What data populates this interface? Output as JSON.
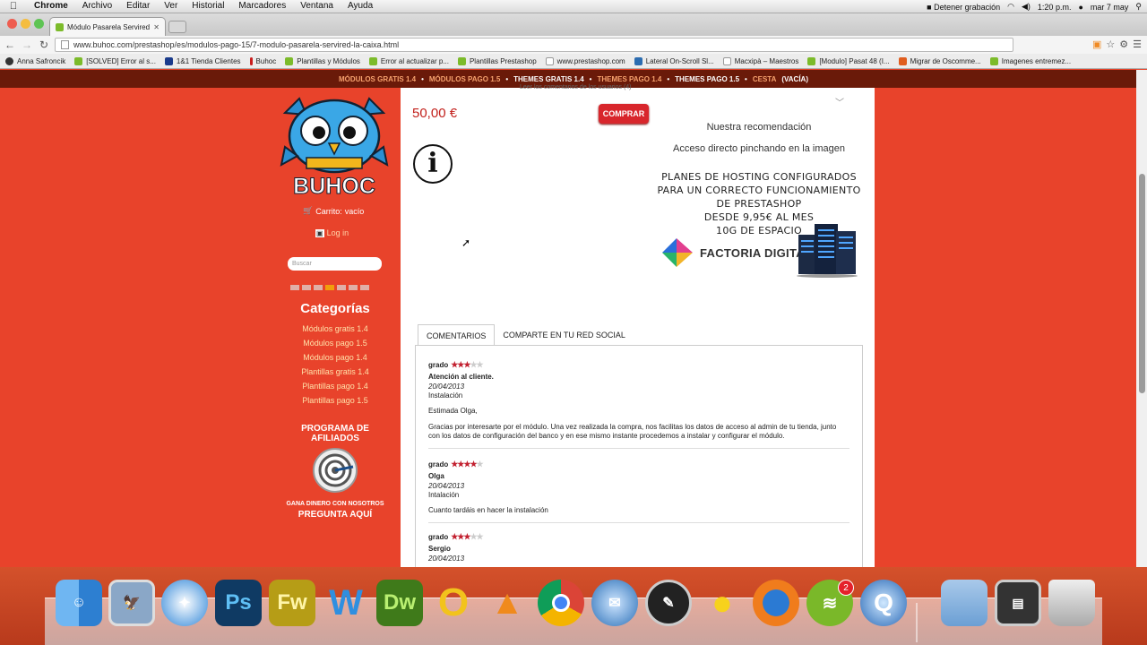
{
  "menubar": {
    "app": "Chrome",
    "items": [
      "Archivo",
      "Editar",
      "Ver",
      "Historial",
      "Marcadores",
      "Ventana",
      "Ayuda"
    ],
    "recording": "Detener grabación",
    "time": "1:20 p.m.",
    "date": "mar 7 may"
  },
  "browser": {
    "tab_title": "Módulo Pasarela Servired",
    "url": "www.buhoc.com/prestashop/es/modulos-pago-15/7-modulo-pasarela-servired-la-caixa.html",
    "bookmarks": [
      "Anna Safroncik",
      "[SOLVED] Error al s...",
      "1&1 Tienda Clientes",
      "Buhoc",
      "Plantillas y Módulos",
      "Error al actualizar p...",
      "Plantillas Prestashop",
      "www.prestashop.com",
      "Lateral On-Scroll Sl...",
      "Macxipà – Maestros",
      "[Modulo] Pasat 48 (I...",
      "Migrar de Oscomme...",
      "Imagenes entremez..."
    ]
  },
  "topnav": {
    "items": [
      {
        "label": "MÓDULOS GRATIS 1.4",
        "highlight": true
      },
      {
        "label": "MÓDULOS PAGO 1.5",
        "highlight": true
      },
      {
        "label": "THEMES GRATIS 1.4",
        "highlight": false
      },
      {
        "label": "THEMES PAGO 1.4",
        "highlight": true
      },
      {
        "label": "THEMES PAGO 1.5",
        "highlight": false
      },
      {
        "label": "CESTA",
        "highlight": true
      },
      {
        "label": "(VACÍA)",
        "highlight": false
      }
    ],
    "ghost_text": "Leer los comentarios de los usuarios (4)"
  },
  "sidebar": {
    "logo_text": "BUHOC",
    "cart_label": "Carrito:",
    "cart_value": "vacío",
    "login": "Log in",
    "search_placeholder": "Buscar",
    "categories_title": "Categorías",
    "categories": [
      "Módulos gratis 1.4",
      "Módulos pago 1.5",
      "Módulos pago 1.4",
      "Plantillas gratis 1.4",
      "Plantillas pago 1.4",
      "Plantillas pago 1.5"
    ],
    "affiliate_title": "PROGRAMA DE AFILIADOS",
    "affiliate_sub": "GANA DINERO CON NOSOTROS",
    "affiliate_cta": "PREGUNTA AQUÍ"
  },
  "product": {
    "price": "50,00 €",
    "buy_label": "COMPRAR"
  },
  "promo": {
    "recommendation": "Nuestra recomendación",
    "direct_access": "Acceso directo pinchando en la imagen",
    "line1": "PLANES DE HOSTING CONFIGURADOS",
    "line2": "PARA UN CORRECTO FUNCIONAMIENTO",
    "line3": "DE PRESTASHOP",
    "line4": "DESDE 9,95€ AL MES",
    "line5": "10G DE ESPACIO",
    "brand": "FACTORIA DIGITAL"
  },
  "tabs": {
    "comments": "COMENTARIOS",
    "share": "COMPARTE EN TU RED SOCIAL"
  },
  "comments": [
    {
      "grade_label": "grado",
      "rating": 3,
      "name": "Atención al cliente.",
      "date": "20/04/2013",
      "subject": "Instalación",
      "greeting": "Estimada Olga,",
      "text": "Gracias por interesarte por el módulo. Una vez realizada la compra, nos facilitas los datos de acceso al admin de tu tienda, junto con los datos de configuración del banco y en ese mismo instante procedemos a instalar y configurar el módulo."
    },
    {
      "grade_label": "grado",
      "rating": 4,
      "name": "Olga",
      "date": "20/04/2013",
      "subject": "Intalación",
      "text": "Cuanto tardáis en hacer la instalación"
    },
    {
      "grade_label": "grado",
      "rating": 3,
      "name": "Sergio",
      "date": "20/04/2013"
    }
  ],
  "dock": {
    "apps": [
      "finder-icon",
      "preview-icon",
      "safari-icon",
      "photoshop-icon",
      "fireworks-icon",
      "word-icon",
      "dreamweaver-icon",
      "opera-icon",
      "vlc-icon",
      "chrome-icon",
      "thunderbird-icon",
      "dashboard-icon",
      "cyberduck-icon",
      "firefox-icon",
      "spotify-icon",
      "quicktime-icon",
      "folder-icon",
      "terminal-icon",
      "trash-icon"
    ],
    "spotify_badge": "2"
  },
  "colors": {
    "page_bg": "#e8432b",
    "nav_bg": "#6a1a09",
    "price": "#c2201b",
    "buy_btn": "#d8262c",
    "star": "#c2202f"
  }
}
